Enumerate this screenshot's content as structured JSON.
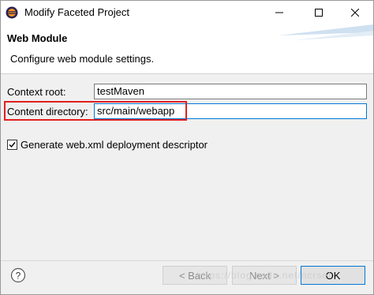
{
  "window": {
    "title": "Modify Faceted Project"
  },
  "banner": {
    "title": "Web Module",
    "description": "Configure web module settings."
  },
  "form": {
    "context_root_label": "Context root:",
    "context_root_value": "testMaven",
    "content_directory_label": "Content directory:",
    "content_directory_value": "src/main/webapp",
    "generate_descriptor_label": "Generate web.xml deployment descriptor",
    "generate_descriptor_checked": true
  },
  "footer": {
    "back_label": "< Back",
    "next_label": "Next >",
    "ok_label": "OK",
    "watermark": "https://blog.csdn.net/ncrsel"
  },
  "colors": {
    "highlight": "#e02020",
    "focus_border": "#0078d7"
  }
}
